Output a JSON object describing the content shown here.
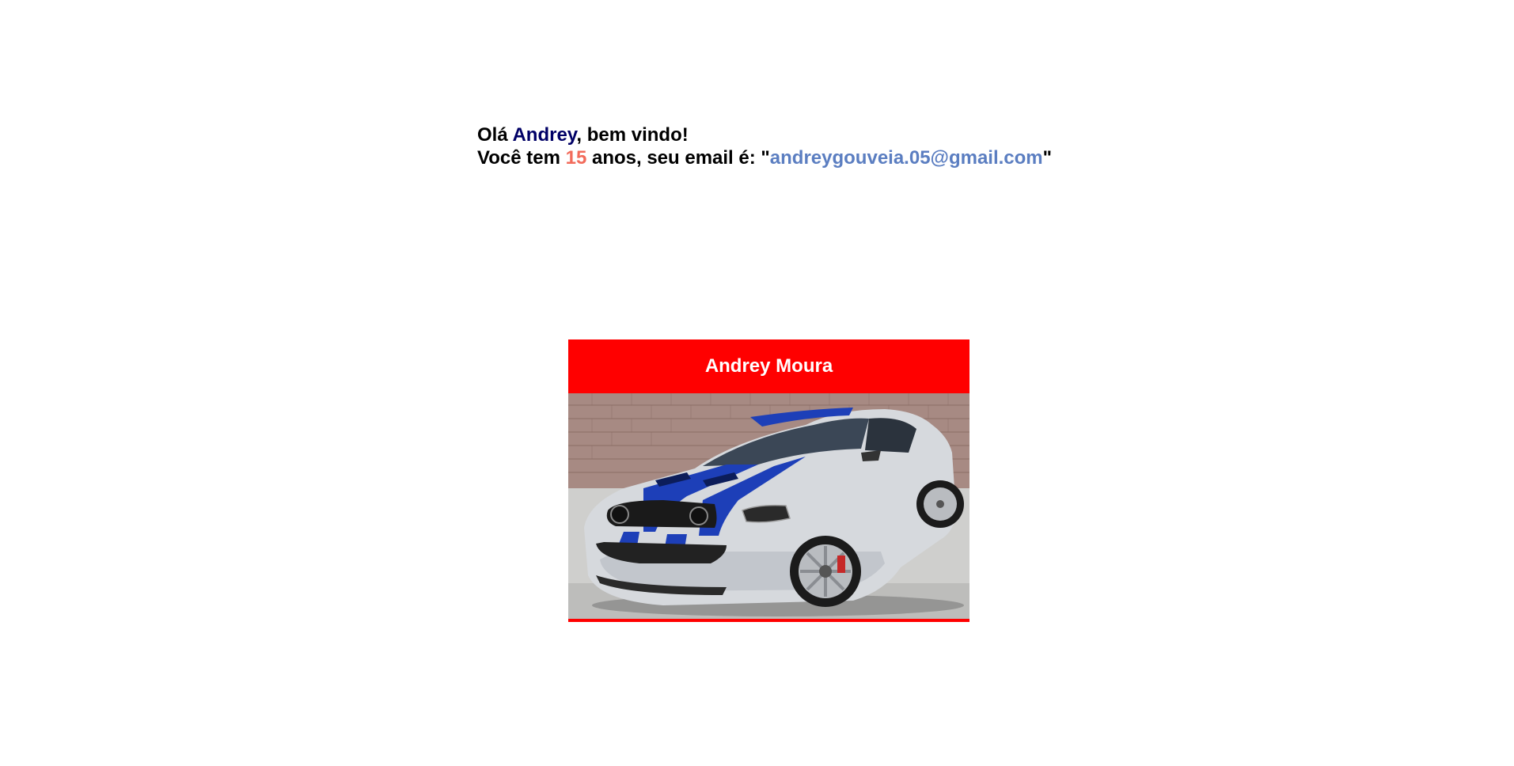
{
  "greeting": {
    "hello_prefix": "Olá ",
    "first_name": "Andrey",
    "hello_suffix": ", bem vindo!",
    "age_prefix": "Você tem ",
    "age": "15",
    "email_prefix": " anos, seu email é: \"",
    "email": "andreygouveia.05@gmail.com",
    "email_suffix": "\""
  },
  "card": {
    "title": "Andrey Moura",
    "image_alt": "car-image",
    "accent_color": "#ff0000"
  },
  "colors": {
    "name": "#000066",
    "age": "#f26b5b",
    "email": "#5b7ec1"
  }
}
